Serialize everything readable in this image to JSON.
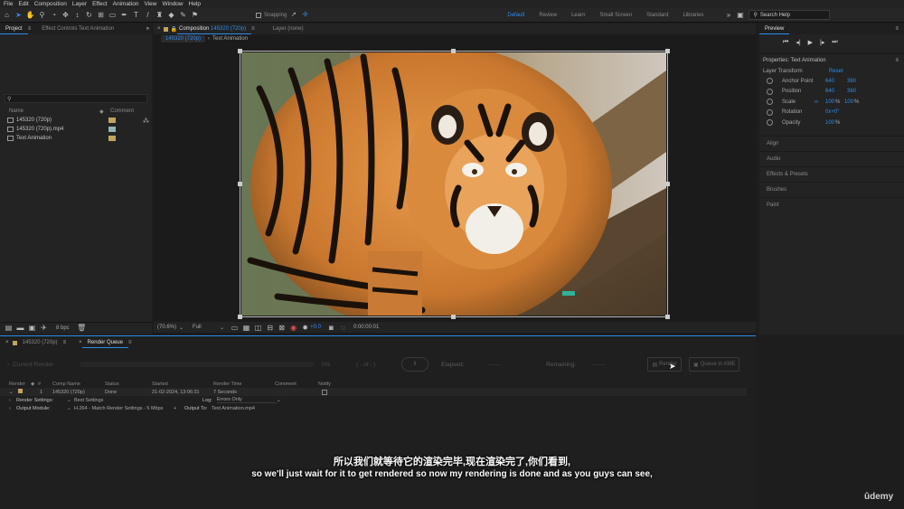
{
  "menu": [
    "File",
    "Edit",
    "Composition",
    "Layer",
    "Effect",
    "Animation",
    "View",
    "Window",
    "Help"
  ],
  "toolbar": {
    "snapping_label": "Snapping",
    "workspaces": [
      {
        "label": "Default",
        "active": true
      },
      {
        "label": "Review",
        "active": false
      },
      {
        "label": "Learn",
        "active": false
      },
      {
        "label": "Small Screen",
        "active": false
      },
      {
        "label": "Standard",
        "active": false
      },
      {
        "label": "Libraries",
        "active": false
      }
    ],
    "search_placeholder": "Search Help"
  },
  "project_panel": {
    "tab_project": "Project",
    "tab_effect_controls": "Effect Controls Text Animation",
    "col_name": "Name",
    "col_comment": "Comment",
    "items": [
      {
        "name": "145320 (720p)",
        "color": "#c3a45e"
      },
      {
        "name": "145320 (720p).mp4",
        "color": "#8fb6b4"
      },
      {
        "name": "Text Animation",
        "color": "#c3a45e"
      }
    ],
    "bpc_label": "8 bpc"
  },
  "composition_panel": {
    "tab_prefix": "Composition",
    "tab_name": "145320 (720p)",
    "layer_tab": "Layer (none)",
    "subtabs": [
      "145320 (720p)",
      "Text Animation"
    ],
    "zoom": "(70.6%)",
    "resolution": "Full",
    "exposure": "+0.0",
    "timecode": "0:00:00:01"
  },
  "preview_panel": {
    "title": "Preview"
  },
  "properties_panel": {
    "title": "Properties: Text Animation",
    "layer_transform": "Layer Transform",
    "reset": "Reset",
    "props": [
      {
        "name": "Anchor Point",
        "v1": "640",
        "v2": "360",
        "unit": ""
      },
      {
        "name": "Position",
        "v1": "640",
        "v2": "360",
        "unit": ""
      },
      {
        "name": "Scale",
        "v1": "100",
        "v2": "100",
        "unit": "%"
      },
      {
        "name": "Rotation",
        "v1": "0x+0°",
        "v2": "",
        "unit": ""
      },
      {
        "name": "Opacity",
        "v1": "100",
        "v2": "",
        "unit": "%"
      }
    ],
    "sections": [
      "Align",
      "Audio",
      "Effects & Presets",
      "Brushes",
      "Paint"
    ]
  },
  "render_queue": {
    "tab_comp": "145320 (720p)",
    "tab_rq": "Render Queue",
    "current_render": "Current Render",
    "percent": "0%",
    "time": "( - of - )",
    "elapsed_label": "Elapsed:",
    "elapsed_value": "------",
    "remaining_label": "Remaining:",
    "remaining_value": "------",
    "btn_render": "Render",
    "btn_ame": "Queue in AME",
    "headers": [
      "Render",
      "#",
      "Comp Name",
      "Status",
      "Started",
      "Render Time",
      "Comment",
      "Notify"
    ],
    "item": {
      "num": "1",
      "comp": "145320 (720p)",
      "status": "Done",
      "started": "21-02-2024, 13:06:31",
      "render_time": "7 Seconds"
    },
    "render_settings_label": "Render Settings:",
    "render_settings_value": "Best Settings",
    "log_label": "Log:",
    "log_value": "Errors Only",
    "output_module_label": "Output Module:",
    "output_module_value": "H.264 - Match Render Settings - 5 Mbps",
    "output_to_label": "Output To:",
    "output_to_value": "Text Animation.mp4"
  },
  "subtitles": {
    "chinese": "所以我们就等待它的渲染完毕,现在渲染完了,你们看到,",
    "english": "so we'll just wait for it to get rendered so now my rendering is done and as you guys can see,"
  },
  "watermark": "ûdemy"
}
